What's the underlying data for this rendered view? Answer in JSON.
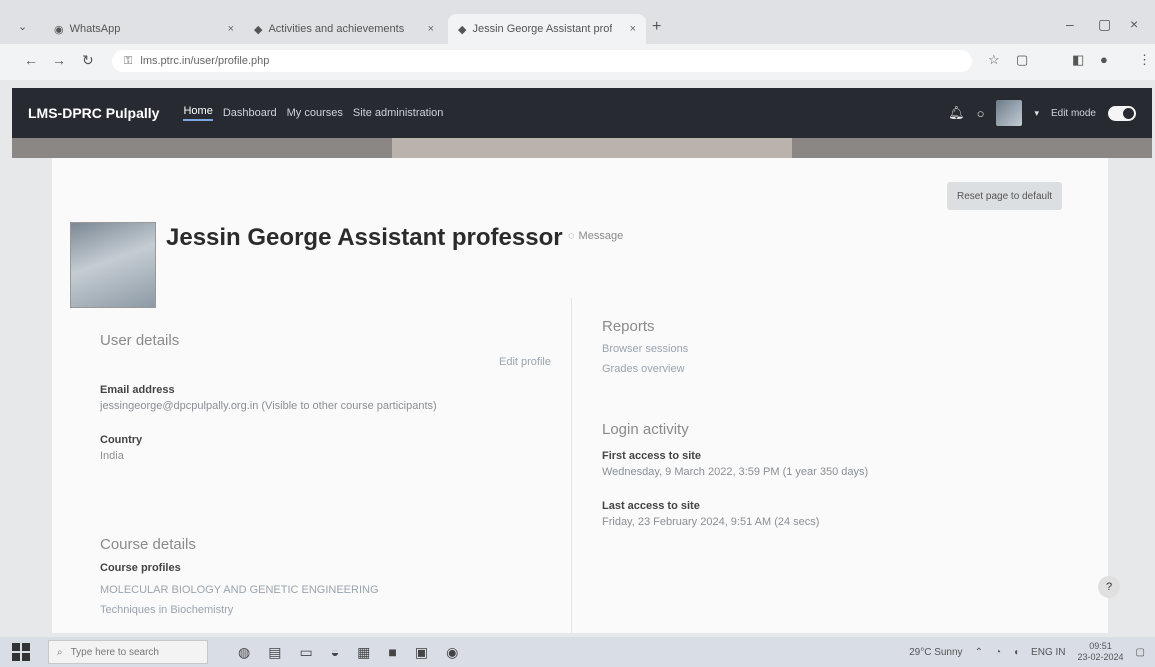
{
  "browser": {
    "tabs": [
      {
        "label": "WhatsApp"
      },
      {
        "label": "Activities and achievements"
      },
      {
        "label": "Jessin George Assistant professor"
      }
    ],
    "address": "lms.ptrc.in/user/profile.php"
  },
  "navbar": {
    "brand": "LMS-DPRC Pulpally",
    "links": [
      "Home",
      "Dashboard",
      "My courses",
      "Site administration"
    ],
    "edit_mode": "Edit mode"
  },
  "page": {
    "reset_button": "Reset page to default",
    "name": "Jessin George Assistant professor",
    "message": "Message"
  },
  "user_details": {
    "title": "User details",
    "edit_profile": "Edit profile",
    "email_label": "Email address",
    "email_value": "jessingeorge@dpcpulpally.org.in (Visible to other course participants)",
    "country_label": "Country",
    "country_value": "India"
  },
  "course_details": {
    "title": "Course details",
    "profiles_label": "Course profiles",
    "course_1": "MOLECULAR BIOLOGY AND GENETIC ENGINEERING",
    "course_2": "Techniques in Biochemistry"
  },
  "reports": {
    "title": "Reports",
    "browser_sessions": "Browser sessions",
    "grades_overview": "Grades overview"
  },
  "login_activity": {
    "title": "Login activity",
    "first_label": "First access to site",
    "first_value": "Wednesday, 9 March 2022, 3:59 PM (1 year 350 days)",
    "last_label": "Last access to site",
    "last_value": "Friday, 23 February 2024, 9:51 AM (24 secs)"
  },
  "taskbar": {
    "search_placeholder": "Type here to search",
    "weather": "29°C Sunny",
    "lang": "ENG IN",
    "time": "09:51",
    "date": "23-02-2024"
  }
}
